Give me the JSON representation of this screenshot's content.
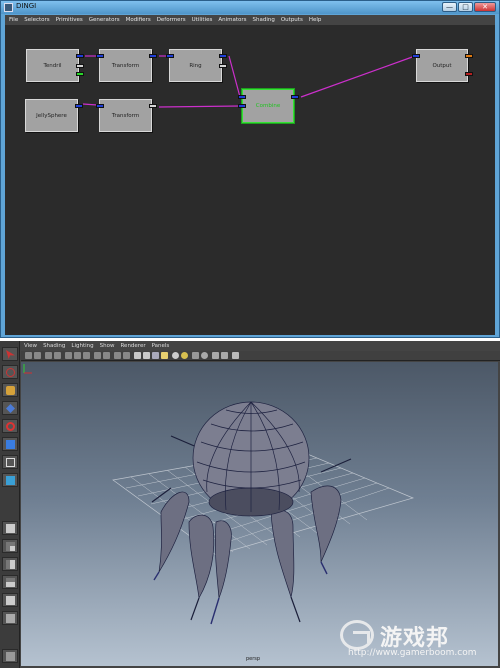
{
  "window": {
    "title": "DINGI",
    "buttons": [
      "—",
      "□",
      "✕"
    ]
  },
  "menubar": [
    "File",
    "Selectors",
    "Primitives",
    "Generators",
    "Modifiers",
    "Deformers",
    "Utilities",
    "Animators",
    "Shading",
    "Outputs",
    "Help"
  ],
  "nodes": [
    {
      "id": "tendril",
      "label": "Tendril"
    },
    {
      "id": "transform1",
      "label": "Transform"
    },
    {
      "id": "ring",
      "label": "Ring"
    },
    {
      "id": "jellysphere",
      "label": "JellySphere"
    },
    {
      "id": "transform2",
      "label": "Transform"
    },
    {
      "id": "combine",
      "label": "Combine"
    },
    {
      "id": "output",
      "label": "Output"
    }
  ],
  "colors": {
    "wire": "#cc2fcc",
    "selected_node": "#35e035",
    "editor_bg": "#2b2b2b"
  },
  "viewport": {
    "menu": [
      "View",
      "Shading",
      "Lighting",
      "Show",
      "Renderer",
      "Panels"
    ],
    "camera_label": "persp",
    "toolbox_icons": [
      "select-arrow-icon",
      "lasso-icon",
      "paint-select-icon",
      "move-icon",
      "rotate-icon",
      "scale-icon",
      "manipulator-icon",
      "last-tool-icon",
      "layout-single-icon",
      "layout-four-icon",
      "layout-side-icon",
      "layout-stack-icon",
      "layout-outliner-icon",
      "layout-graph-icon",
      "layout-uv-icon"
    ]
  },
  "watermark": {
    "cn_text": "游戏邦",
    "url": "http://www.gamerboom.com"
  }
}
